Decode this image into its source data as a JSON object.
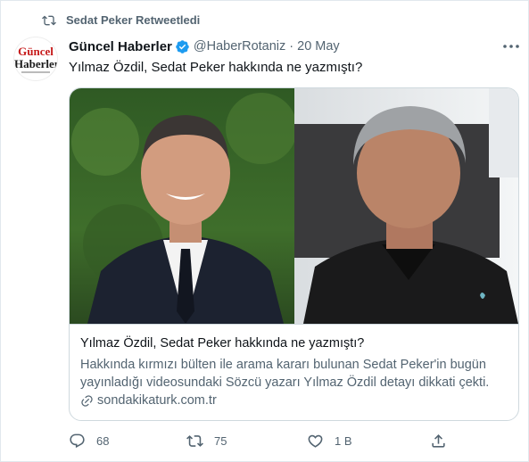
{
  "retweet": {
    "label": "Sedat Peker Retweetledi"
  },
  "avatar": {
    "line1": "Güncel",
    "line2": "Haberler"
  },
  "author": {
    "name": "Güncel Haberler",
    "handle": "@HaberRotaniz",
    "separator": "·",
    "date": "20 May"
  },
  "tweet": {
    "text": "Yılmaz Özdil, Sedat Peker hakkında ne yazmıştı?"
  },
  "card": {
    "title": "Yılmaz Özdil, Sedat Peker hakkında ne yazmıştı?",
    "description": "Hakkında kırmızı bülten ile arama kararı bulunan Sedat Peker'in bugün yayınladığı videosundaki Sözcü yazarı Yılmaz Özdil detayı dikkati çekti.",
    "domain": "sondakikaturk.com.tr"
  },
  "actions": {
    "replies": "68",
    "retweets": "75",
    "likes": "1 B"
  },
  "colors": {
    "verified": "#1d9bf0",
    "secondary_text": "#536471",
    "border": "#cfd9de",
    "avatar_red": "#c61a1a"
  },
  "icons": [
    "retweet-icon",
    "verified-icon",
    "more-icon",
    "link-icon",
    "reply-icon",
    "like-icon",
    "share-icon"
  ]
}
